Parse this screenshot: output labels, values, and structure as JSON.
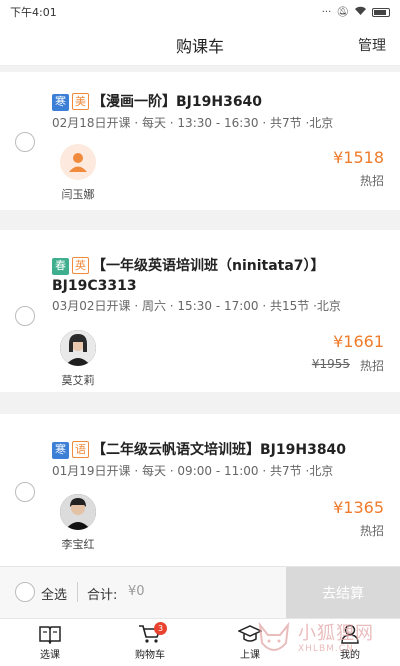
{
  "status_bar": {
    "time": "下午4:01"
  },
  "nav": {
    "title": "购课车",
    "manage": "管理"
  },
  "courses": [
    {
      "tags": [
        "寒",
        "美"
      ],
      "title": "【漫画一阶】BJ19H3640",
      "meta": "02月18日开课 · 每天 · 13:30 - 16:30 · 共7节 ·北京",
      "teacher": "闫玉娜",
      "price": "¥1518",
      "enroll": "热招"
    },
    {
      "tags": [
        "春",
        "英"
      ],
      "title_line1": "【一年级英语培训班（ninitata7）】",
      "title_line2": "BJ19C3313",
      "meta": "03月02日开课 · 周六 · 15:30 - 17:00 · 共15节 ·北京",
      "teacher": "莫艾莉",
      "price": "¥1661",
      "old_price": "¥1955",
      "enroll": "热招"
    },
    {
      "tags": [
        "寒",
        "语"
      ],
      "title": "【二年级云帆语文培训班】BJ19H3840",
      "meta": "01月19日开课 · 每天 · 09:00 - 11:00 · 共7节 ·北京",
      "teacher": "李宝红",
      "price": "¥1365",
      "enroll": "热招"
    }
  ],
  "checkout": {
    "select_all": "全选",
    "total_label": "合计:",
    "total_value": "¥0",
    "button": "去结算"
  },
  "tabs": [
    {
      "label": "选课",
      "icon": "book-icon"
    },
    {
      "label": "购物车",
      "icon": "cart-icon",
      "badge": "3"
    },
    {
      "label": "上课",
      "icon": "graduation-cap-icon"
    },
    {
      "label": "我的",
      "icon": "user-icon"
    }
  ],
  "watermark": {
    "cn": "小狐狸网",
    "en": "XHLBM.CN"
  }
}
